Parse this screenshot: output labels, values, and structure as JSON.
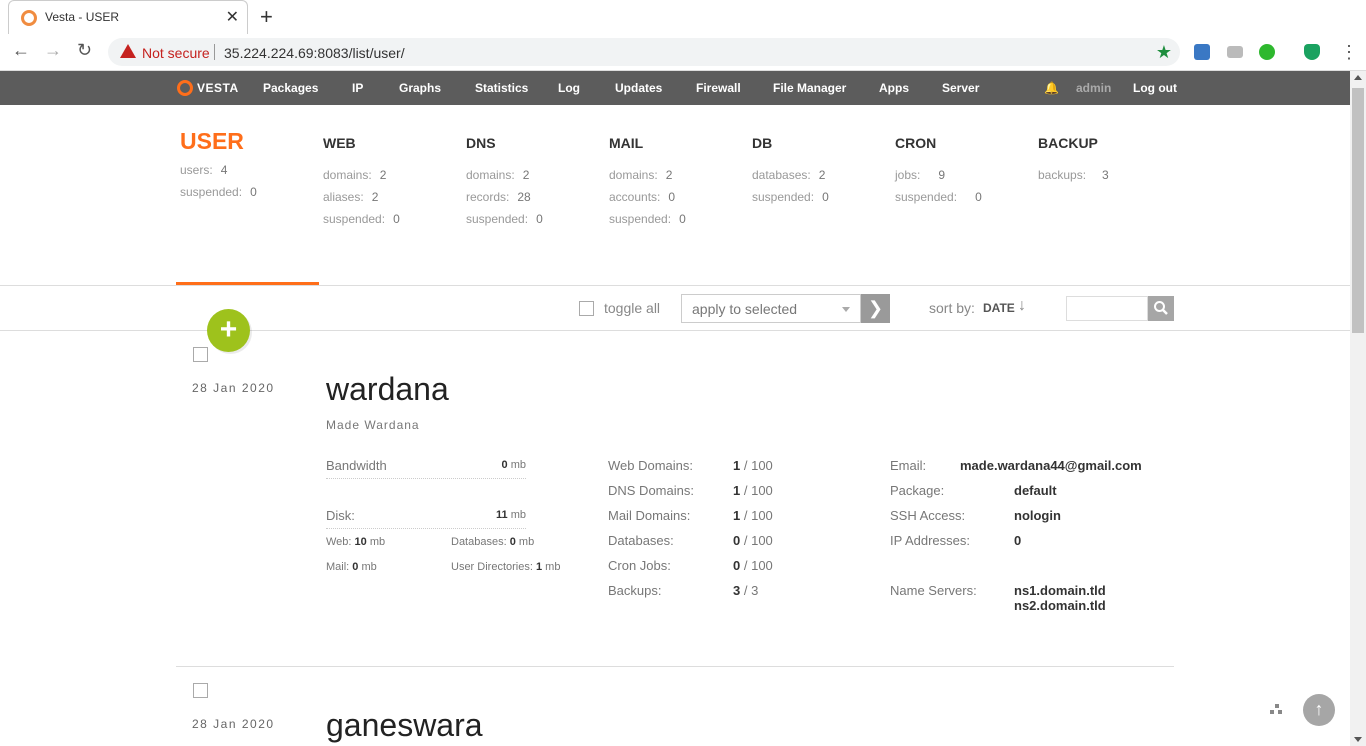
{
  "browser": {
    "tab_title": "Vesta - USER",
    "not_secure": "Not secure",
    "url": "35.224.224.69:8083/list/user/",
    "close_glyph": "✕",
    "new_tab_glyph": "+",
    "back_glyph": "←",
    "forward_glyph": "→",
    "reload_glyph": "↻",
    "star_glyph": "★",
    "menu_glyph": "⋮"
  },
  "vesta": {
    "logo": "VESTA",
    "nav": [
      "Packages",
      "IP",
      "Graphs",
      "Statistics",
      "Log",
      "Updates",
      "Firewall",
      "File Manager",
      "Apps",
      "Server"
    ],
    "bell_glyph": "🔔",
    "user": "admin",
    "logout": "Log out"
  },
  "stats": [
    {
      "title": "USER",
      "rows": [
        {
          "k": "users:",
          "v": "4"
        },
        {
          "k": "suspended:",
          "v": "0"
        }
      ]
    },
    {
      "title": "WEB",
      "rows": [
        {
          "k": "domains:",
          "v": "2"
        },
        {
          "k": "aliases:",
          "v": "2"
        },
        {
          "k": "suspended:",
          "v": "0"
        }
      ]
    },
    {
      "title": "DNS",
      "rows": [
        {
          "k": "domains:",
          "v": "2"
        },
        {
          "k": "records:",
          "v": "28"
        },
        {
          "k": "suspended:",
          "v": "0"
        }
      ]
    },
    {
      "title": "MAIL",
      "rows": [
        {
          "k": "domains:",
          "v": "2"
        },
        {
          "k": "accounts:",
          "v": "0"
        },
        {
          "k": "suspended:",
          "v": "0"
        }
      ]
    },
    {
      "title": "DB",
      "rows": [
        {
          "k": "databases:",
          "v": "2"
        },
        {
          "k": "suspended:",
          "v": "0"
        }
      ]
    },
    {
      "title": "CRON",
      "rows": [
        {
          "k": "jobs:",
          "v": "9"
        },
        {
          "k": "suspended:",
          "v": "0"
        }
      ]
    },
    {
      "title": "BACKUP",
      "rows": [
        {
          "k": "backups:",
          "v": "3"
        }
      ]
    }
  ],
  "toolbar": {
    "toggle_all": "toggle all",
    "apply_to_selected": "apply to selected",
    "apply_glyph": "❯",
    "sort_by": "sort by:",
    "sort_value": "DATE",
    "sort_arrow": "↓",
    "add_glyph": "+"
  },
  "users": [
    {
      "date": "28  Jan  2020",
      "username": "wardana",
      "fullname": "Made Wardana",
      "bandwidth_label": "Bandwidth",
      "bandwidth_value": "0",
      "disk_label": "Disk:",
      "disk_value": "11",
      "unit": "mb",
      "disk_web_label": "Web:",
      "disk_web": "10",
      "disk_db_label": "Databases:",
      "disk_db": "0",
      "disk_mail_label": "Mail:",
      "disk_mail": "0",
      "disk_dirs_label": "User Directories:",
      "disk_dirs": "1",
      "limits": [
        {
          "label": "Web Domains:",
          "used": "1",
          "max": "/ 100"
        },
        {
          "label": "DNS Domains:",
          "used": "1",
          "max": "/ 100"
        },
        {
          "label": "Mail Domains:",
          "used": "1",
          "max": "/ 100"
        },
        {
          "label": "Databases:",
          "used": "0",
          "max": "/ 100"
        },
        {
          "label": "Cron Jobs:",
          "used": "0",
          "max": "/ 100"
        },
        {
          "label": "Backups:",
          "used": "3",
          "max": "/ 3"
        }
      ],
      "email_label": "Email:",
      "email": "made.wardana44@gmail.com",
      "package_label": "Package:",
      "package": "default",
      "ssh_label": "SSH Access:",
      "ssh": "nologin",
      "ip_label": "IP Addresses:",
      "ip": "0",
      "ns_label": "Name Servers:",
      "ns1": "ns1.domain.tld",
      "ns2": "ns2.domain.tld"
    },
    {
      "date": "28  Jan  2020",
      "username": "ganeswara"
    }
  ],
  "to_top_glyph": "↑"
}
